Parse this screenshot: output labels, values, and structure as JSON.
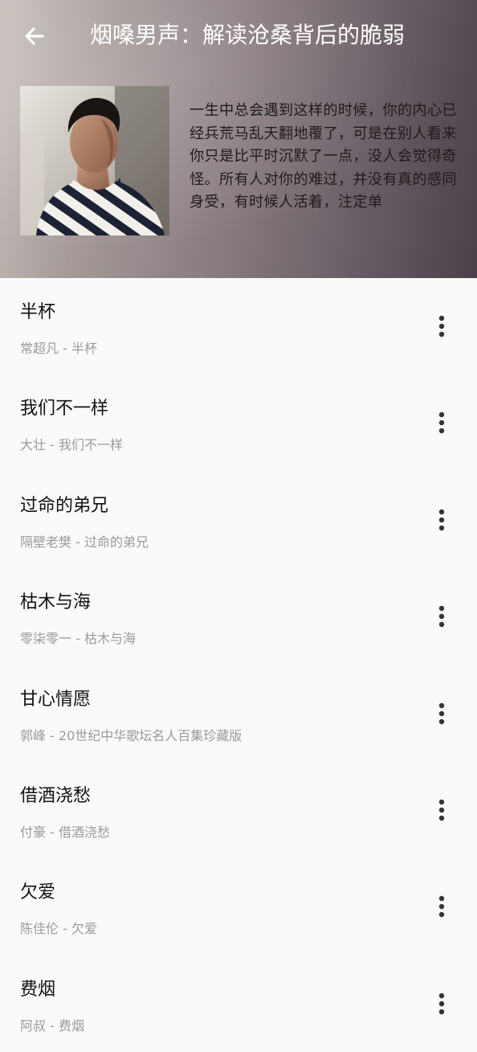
{
  "header": {
    "title": "烟嗓男声：解读沧桑背后的脆弱",
    "description": "一生中总会遇到这样的时候，你的内心已经兵荒马乱天翻地覆了，可是在别人看来你只是比平时沉默了一点，没人会觉得奇怪。所有人对你的难过，并没有真的感同身受，有时候人活着，注定单"
  },
  "icons": {
    "back": "arrow-left-icon",
    "more": "more-vertical-icon"
  },
  "songs": [
    {
      "title": "半杯",
      "meta": "常超凡 - 半杯"
    },
    {
      "title": "我们不一样",
      "meta": "大壮 - 我们不一样"
    },
    {
      "title": "过命的弟兄",
      "meta": "隔壁老樊 - 过命的弟兄"
    },
    {
      "title": "枯木与海",
      "meta": "零柒零一 - 枯木与海"
    },
    {
      "title": "甘心情愿",
      "meta": "郭峰 - 20世纪中华歌坛名人百集珍藏版"
    },
    {
      "title": "借酒浇愁",
      "meta": "付豪 - 借酒浇愁"
    },
    {
      "title": "欠爱",
      "meta": "陈佳伦 - 欠爱"
    },
    {
      "title": "费烟",
      "meta": "阿叔 - 费烟"
    }
  ]
}
